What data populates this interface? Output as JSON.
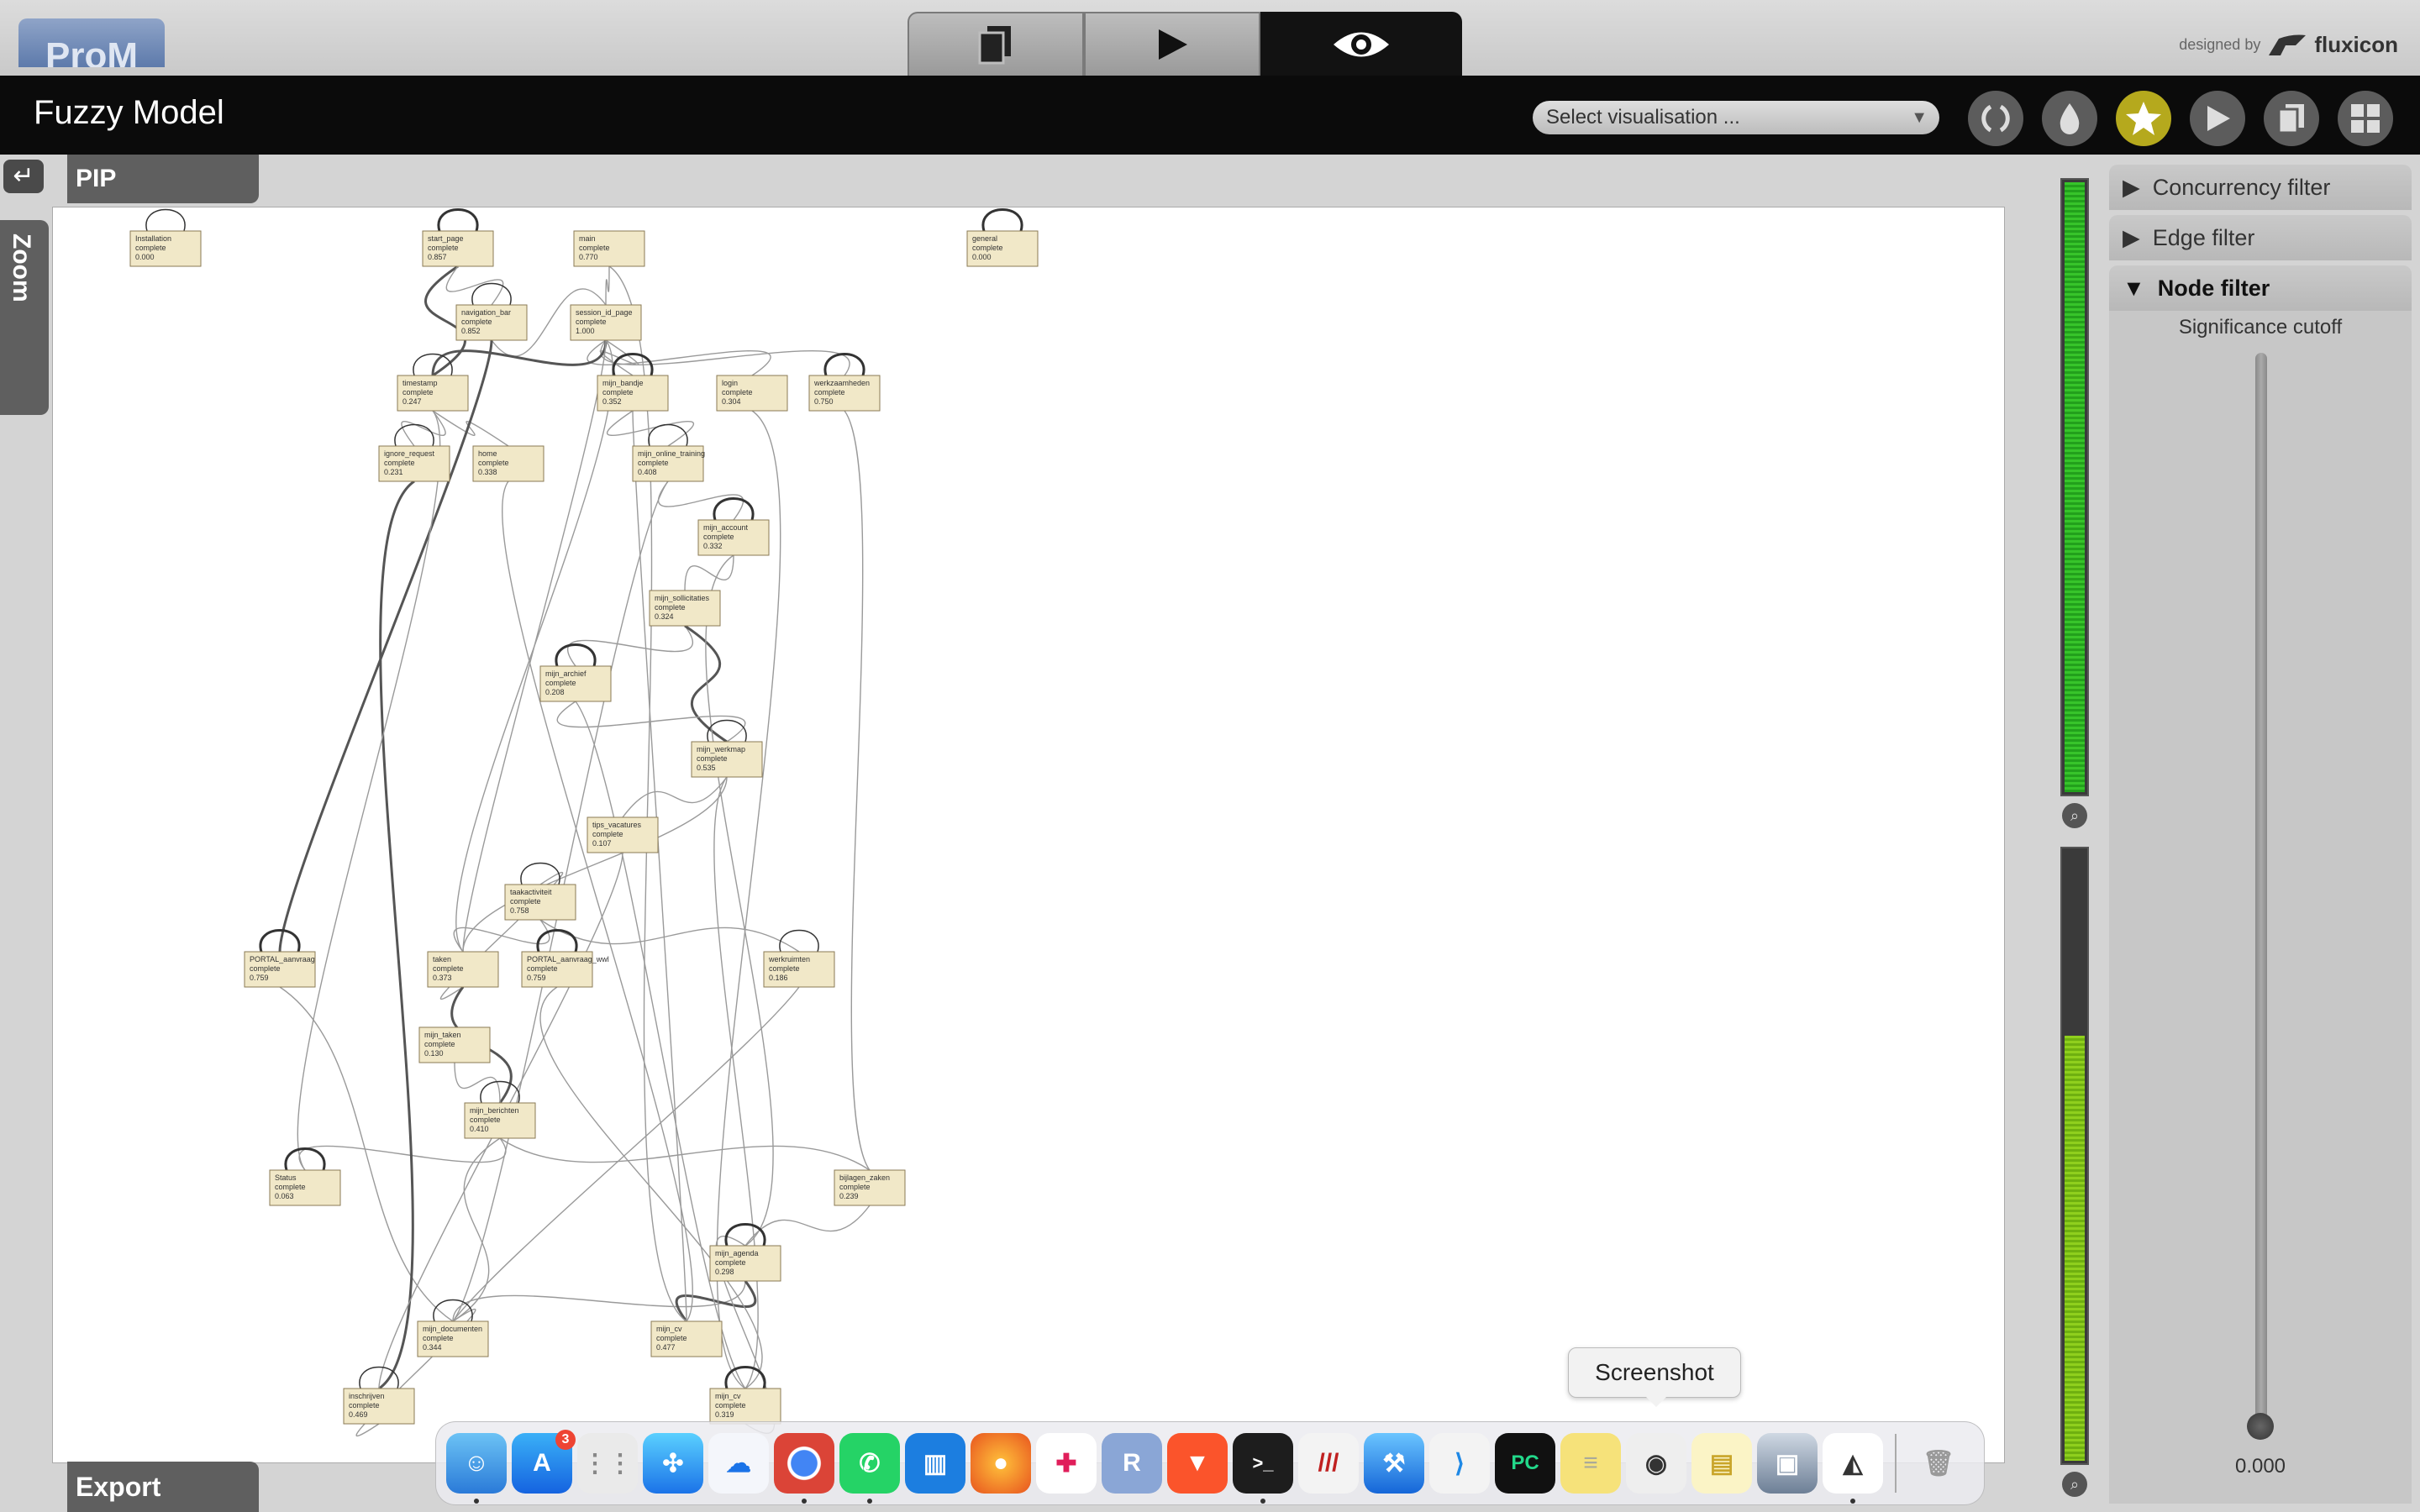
{
  "app": {
    "logo": "ProM",
    "brand_prefix": "designed by",
    "brand_name": "fluxicon"
  },
  "titlebar": {
    "title": "Fuzzy Model",
    "visualisation_select": "Select visualisation ..."
  },
  "left": {
    "pip_label": "PIP",
    "zoom_label": "Zoom",
    "export_label": "Export"
  },
  "filters": {
    "concurrency": "Concurrency filter",
    "edge": "Edge filter",
    "node": "Node filter",
    "significance_label": "Significance cutoff",
    "significance_value": "0.000"
  },
  "meters": {
    "top_fill": 1.0,
    "bottom_fill": 0.7
  },
  "tooltip": {
    "text": "Screenshot"
  },
  "dock": {
    "app_store_badge": "3"
  },
  "graph": {
    "nodes": [
      {
        "id": "n1",
        "name": "Installation",
        "sub": "complete",
        "value": "0.000"
      },
      {
        "id": "n2",
        "name": "start_page",
        "sub": "complete",
        "value": "0.857"
      },
      {
        "id": "n3",
        "name": "main",
        "sub": "complete",
        "value": "0.770"
      },
      {
        "id": "n4",
        "name": "general",
        "sub": "complete",
        "value": "0.000"
      },
      {
        "id": "n5",
        "name": "navigation_bar",
        "sub": "complete",
        "value": "0.852"
      },
      {
        "id": "n6",
        "name": "session_id_page",
        "sub": "complete",
        "value": "1.000"
      },
      {
        "id": "n7",
        "name": "timestamp",
        "sub": "complete",
        "value": "0.247"
      },
      {
        "id": "n8",
        "name": "mijn_bandje",
        "sub": "complete",
        "value": "0.352"
      },
      {
        "id": "n9",
        "name": "login",
        "sub": "complete",
        "value": "0.304"
      },
      {
        "id": "n10",
        "name": "werkzaamheden",
        "sub": "complete",
        "value": "0.750"
      },
      {
        "id": "n11",
        "name": "ignore_request",
        "sub": "complete",
        "value": "0.231"
      },
      {
        "id": "n12",
        "name": "home",
        "sub": "complete",
        "value": "0.338"
      },
      {
        "id": "n13",
        "name": "mijn_online_training",
        "sub": "complete",
        "value": "0.408"
      },
      {
        "id": "n14",
        "name": "mijn_account",
        "sub": "complete",
        "value": "0.332"
      },
      {
        "id": "n15",
        "name": "mijn_sollicitaties",
        "sub": "complete",
        "value": "0.324"
      },
      {
        "id": "n16",
        "name": "mijn_archief",
        "sub": "complete",
        "value": "0.208"
      },
      {
        "id": "n17",
        "name": "mijn_werkmap",
        "sub": "complete",
        "value": "0.535"
      },
      {
        "id": "n18",
        "name": "tips_vacatures",
        "sub": "complete",
        "value": "0.107"
      },
      {
        "id": "n19",
        "name": "taakactiviteit",
        "sub": "complete",
        "value": "0.758"
      },
      {
        "id": "n20",
        "name": "PORTAL_aanvraag",
        "sub": "complete",
        "value": "0.759"
      },
      {
        "id": "n21",
        "name": "taken",
        "sub": "complete",
        "value": "0.373"
      },
      {
        "id": "n22",
        "name": "PORTAL_aanvraag_wwl",
        "sub": "complete",
        "value": "0.759"
      },
      {
        "id": "n23",
        "name": "werkruimten",
        "sub": "complete",
        "value": "0.186"
      },
      {
        "id": "n24",
        "name": "mijn_taken",
        "sub": "complete",
        "value": "0.130"
      },
      {
        "id": "n25",
        "name": "mijn_berichten",
        "sub": "complete",
        "value": "0.410"
      },
      {
        "id": "n26",
        "name": "Status",
        "sub": "complete",
        "value": "0.063"
      },
      {
        "id": "n27",
        "name": "bijlagen_zaken",
        "sub": "complete",
        "value": "0.239"
      },
      {
        "id": "n28",
        "name": "mijn_agenda",
        "sub": "complete",
        "value": "0.298"
      },
      {
        "id": "n29",
        "name": "mijn_documenten",
        "sub": "complete",
        "value": "0.344"
      },
      {
        "id": "n30",
        "name": "mijn_cv",
        "sub": "complete",
        "value": "0.477"
      },
      {
        "id": "n31",
        "name": "inschrijven",
        "sub": "complete",
        "value": "0.469"
      },
      {
        "id": "n32",
        "name": "mijn_cv",
        "sub": "complete",
        "value": "0.319"
      }
    ]
  }
}
